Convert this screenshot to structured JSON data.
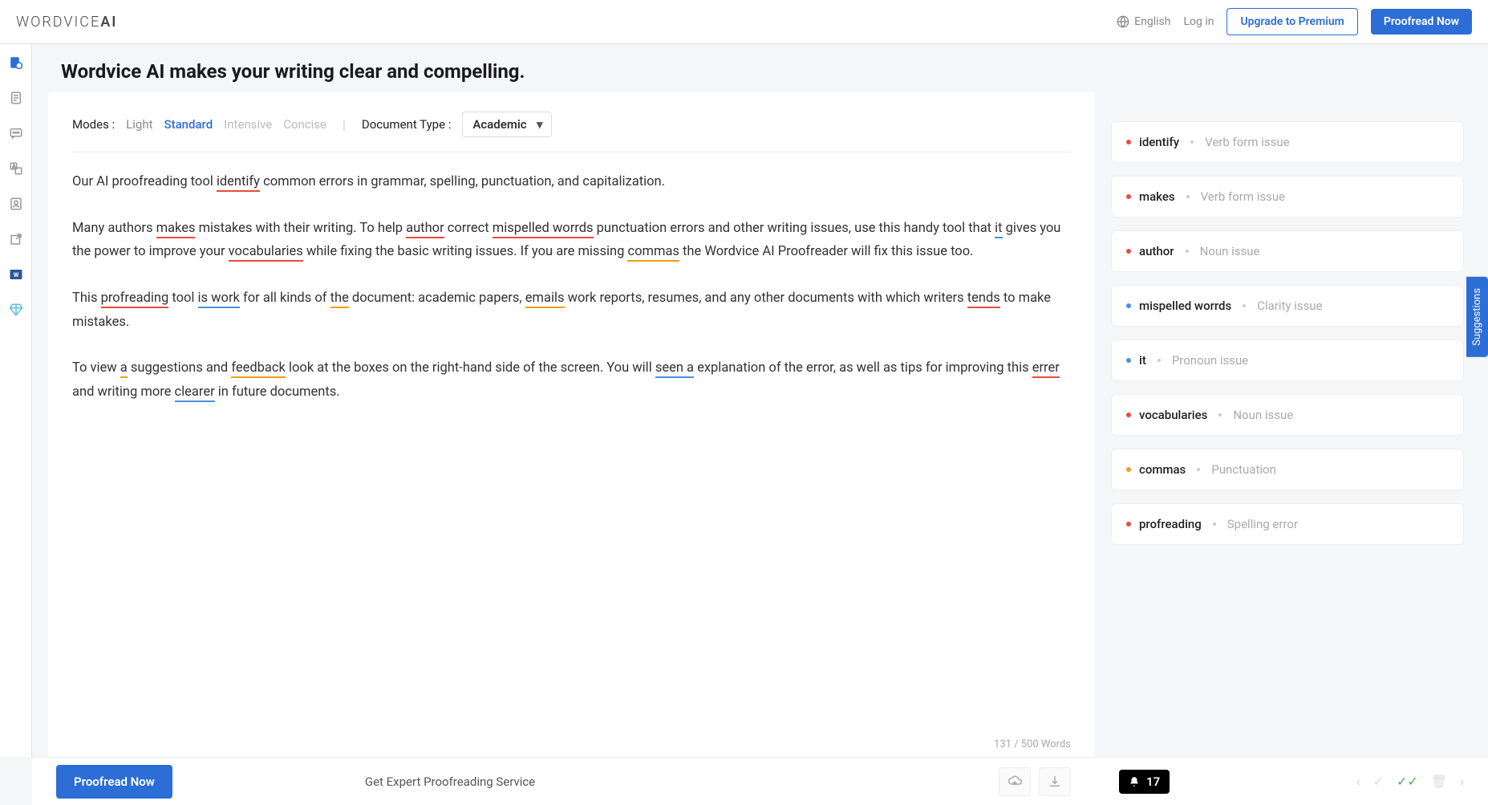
{
  "header": {
    "logo_prefix": "WORDVICE",
    "logo_suffix": "AI",
    "language": "English",
    "login": "Log in",
    "upgrade": "Upgrade to Premium",
    "proofread": "Proofread Now"
  },
  "page_title": "Wordvice AI makes your writing clear and compelling.",
  "toolbar": {
    "modes_label": "Modes :",
    "modes": [
      "Light",
      "Standard",
      "Intensive",
      "Concise"
    ],
    "doc_type_label": "Document Type :",
    "doc_type_value": "Academic"
  },
  "editor": {
    "word_count": "131 / 500 Words"
  },
  "suggestions": [
    {
      "color": "red",
      "word": "identify",
      "issue": "Verb form issue"
    },
    {
      "color": "red",
      "word": "makes",
      "issue": "Verb form issue"
    },
    {
      "color": "red",
      "word": "author",
      "issue": "Noun issue"
    },
    {
      "color": "blue",
      "word": "mispelled worrds",
      "issue": "Clarity issue"
    },
    {
      "color": "blue",
      "word": "it",
      "issue": "Pronoun issue"
    },
    {
      "color": "red",
      "word": "vocabularies",
      "issue": "Noun issue"
    },
    {
      "color": "orange",
      "word": "commas",
      "issue": "Punctuation"
    },
    {
      "color": "red",
      "word": "profreading",
      "issue": "Spelling error"
    }
  ],
  "suggestions_tab": "Suggestions",
  "footer": {
    "proofread_btn": "Proofread Now",
    "expert_link": "Get Expert Proofreading Service",
    "issue_count": "17"
  }
}
